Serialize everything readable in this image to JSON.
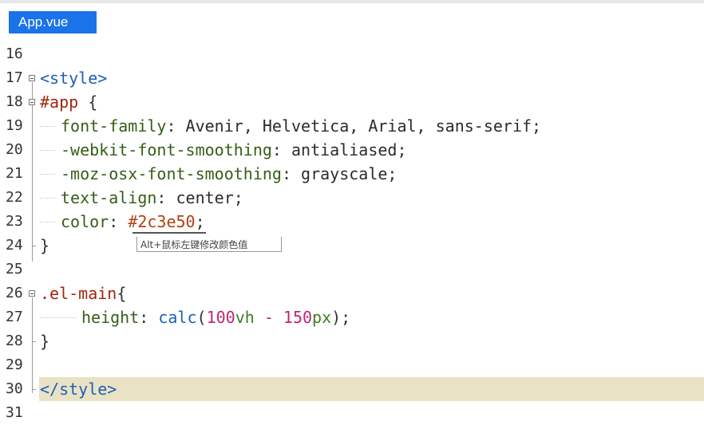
{
  "tab": {
    "label": "App.vue"
  },
  "lines": [
    {
      "num": "16"
    },
    {
      "num": "17",
      "tokens": [
        "<style>"
      ]
    },
    {
      "num": "18",
      "tokens": [
        "#app",
        " {"
      ]
    },
    {
      "num": "19",
      "tokens": [
        "font-family",
        ": ",
        "Avenir, Helvetica, Arial, sans-serif",
        ";"
      ]
    },
    {
      "num": "20",
      "tokens": [
        "-webkit-font-smoothing",
        ": ",
        "antialiased",
        ";"
      ]
    },
    {
      "num": "21",
      "tokens": [
        "-moz-osx-font-smoothing",
        ": ",
        "grayscale",
        ";"
      ]
    },
    {
      "num": "22",
      "tokens": [
        "text-align",
        ": ",
        "center",
        ";"
      ]
    },
    {
      "num": "23",
      "tokens": [
        "color",
        ": ",
        "#2c3e50",
        ";"
      ]
    },
    {
      "num": "24",
      "tokens": [
        "}"
      ]
    },
    {
      "num": "25"
    },
    {
      "num": "26",
      "tokens": [
        ".el-main",
        "{"
      ]
    },
    {
      "num": "27",
      "tokens": [
        "height",
        ": ",
        "calc",
        "(",
        "100",
        "vh",
        " - ",
        "150",
        "px",
        ");"
      ]
    },
    {
      "num": "28",
      "tokens": [
        "}"
      ]
    },
    {
      "num": "29"
    },
    {
      "num": "30",
      "tokens": [
        "</style>"
      ]
    },
    {
      "num": "31"
    }
  ],
  "tooltip": {
    "text": "Alt+鼠标左键修改颜色值"
  },
  "colors": {
    "tab": "#1a73e8",
    "highlight": "#e9e2c5",
    "tag": "#1f5fb8",
    "selector": "#a1260d",
    "property": "#355e16",
    "number": "#c02672"
  }
}
